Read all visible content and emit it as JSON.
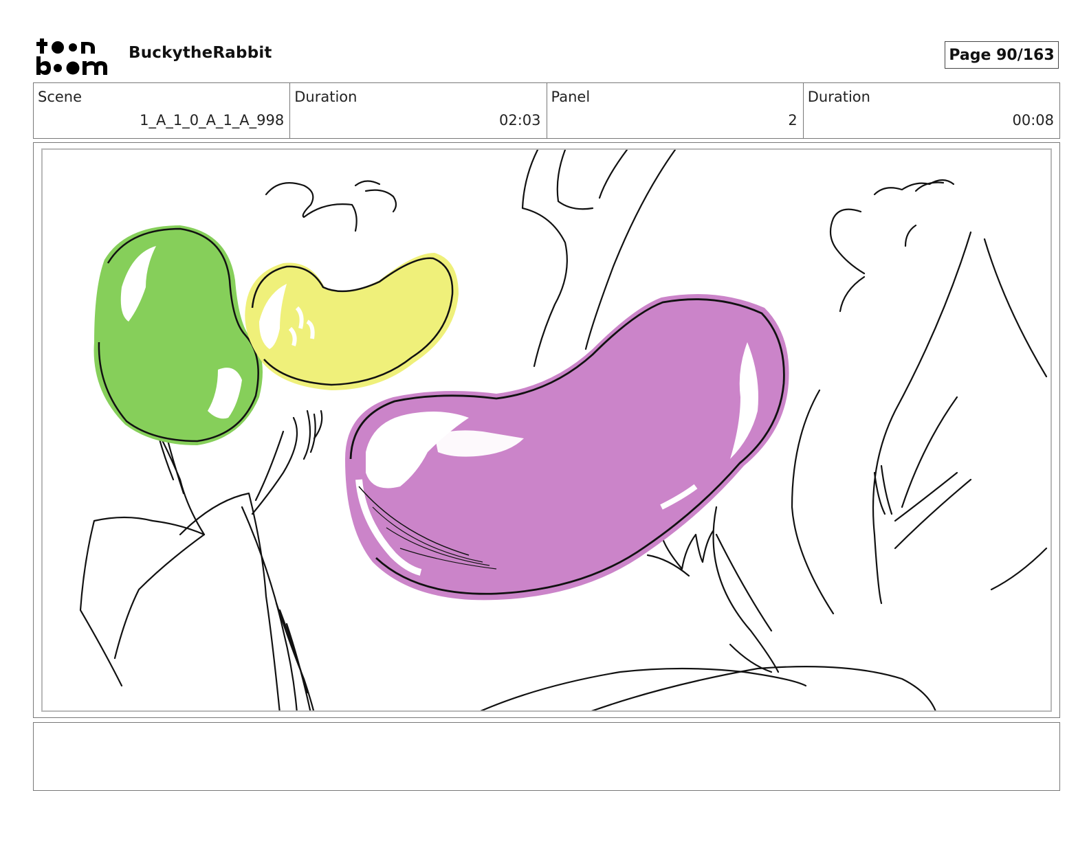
{
  "header": {
    "logo_name": "toon boom logo",
    "project_title": "BuckytheRabbit",
    "page_label": "Page",
    "page_number": "90/163"
  },
  "info": {
    "scene_label": "Scene",
    "scene_value": "1_A_1_0_A_1_A_998",
    "scene_duration_label": "Duration",
    "scene_duration_value": "02:03",
    "panel_label": "Panel",
    "panel_value": "2",
    "panel_duration_label": "Duration",
    "panel_duration_value": "00:08"
  },
  "colors": {
    "green_bean": "#86cf5a",
    "yellow_bean": "#eff07a",
    "purple_bean": "#cb84c9",
    "line": "#111111"
  },
  "notes": {
    "text": ""
  }
}
